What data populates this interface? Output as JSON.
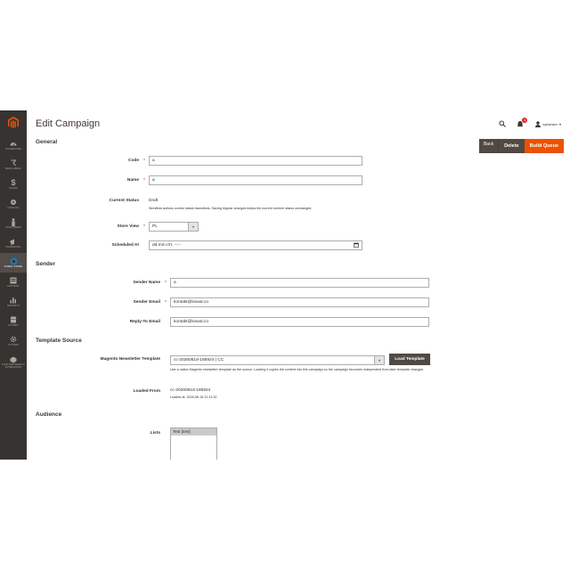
{
  "sidebar": {
    "items": [
      {
        "icon": "dashboard-icon",
        "label": "DASHBOARD"
      },
      {
        "icon": "sales-icon",
        "label": "MEDIA MENU"
      },
      {
        "icon": "dollar-icon",
        "label": "SALES"
      },
      {
        "icon": "catalog-icon",
        "label": "CATALOG"
      },
      {
        "icon": "customers-icon",
        "label": "CUSTOMERS"
      },
      {
        "icon": "marketing-icon",
        "label": "MARKETING"
      },
      {
        "icon": "kowal-store-icon",
        "label": "KOWAL STORE"
      },
      {
        "icon": "content-icon",
        "label": "CONTENT"
      },
      {
        "icon": "reports-icon",
        "label": "REPORTS"
      },
      {
        "icon": "stores-icon",
        "label": "STORES"
      },
      {
        "icon": "system-icon",
        "label": "SYSTEM"
      },
      {
        "icon": "extensions-icon",
        "label": "FIND PARTNERS & EXTENSIONS"
      }
    ],
    "active_index": 6
  },
  "header": {
    "title": "Edit Campaign",
    "notification_count": "1",
    "user_name": "sylwester"
  },
  "buttons": {
    "back": "Back",
    "delete": "Delete",
    "build_queue": "Build Queue",
    "load_template": "Load Template"
  },
  "general": {
    "section_title": "General",
    "code_label": "Code",
    "code_value": "a",
    "name_label": "Name",
    "name_value": "a",
    "status_label": "Current Status",
    "status_value": "Draft",
    "status_note": "Workflow actions control status transitions. Saving regular changes keeps the current runtime status unchanged.",
    "store_view_label": "Store View",
    "store_view_value": "PL",
    "scheduled_label": "Scheduled At",
    "scheduled_placeholder": "dd.mm.rrrr, --:--"
  },
  "sender": {
    "section_title": "Sender",
    "name_label": "Sender Name",
    "name_value": "a",
    "email_label": "Sender Email",
    "email_value": "kontakt@kowal.co",
    "reply_label": "Reply-To Email",
    "reply_value": "kontakt@kowal.co"
  },
  "template_source": {
    "section_title": "Template Source",
    "template_label": "Magento Newsletter Template",
    "template_value": "cc-20260618-185924 | CC",
    "template_note": "Use a native Magento newsletter template as the source. Loading it copies the content into this campaign so the campaign becomes independent from later template changes.",
    "loaded_from_label": "Loaded From",
    "loaded_from_value": "cc-20260618-185924",
    "loaded_at": "Loaded at: 2026-06-18 21:11:20"
  },
  "audience": {
    "section_title": "Audience",
    "lists_label": "Lists",
    "lists_option": "Test [test]"
  },
  "colors": {
    "sidebar_bg": "#373330",
    "accent_orange": "#eb5202",
    "dark_button": "#514943",
    "required": "#e22626"
  }
}
